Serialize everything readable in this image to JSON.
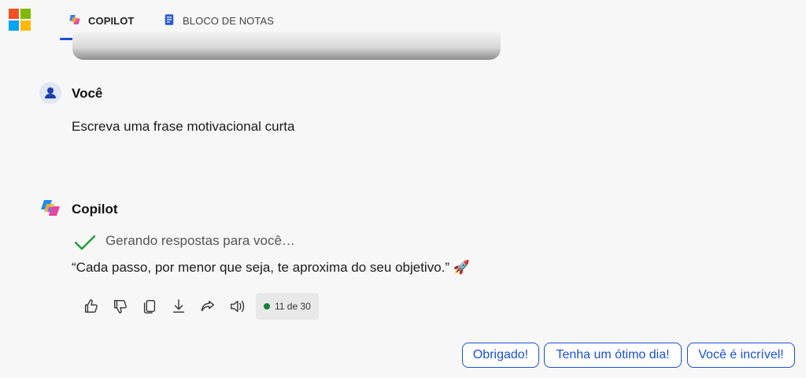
{
  "tabs": [
    {
      "label": "COPILOT",
      "icon": "copilot-icon",
      "active": true
    },
    {
      "label": "BLOCO DE NOTAS",
      "icon": "notebook-icon",
      "active": false
    }
  ],
  "conversation": {
    "user": {
      "name": "Você",
      "message": "Escreva uma frase motivacional curta"
    },
    "copilot": {
      "name": "Copilot",
      "status": "Gerando respostas para você…",
      "message": "“Cada passo, por menor que seja, te aproxima do seu objetivo.” 🚀",
      "counter": "11 de 30"
    }
  },
  "suggestions": [
    "Obrigado!",
    "Tenha um ótimo dia!",
    "Você é incrível!"
  ],
  "colors": {
    "accent": "#1a4fd6",
    "check": "#1e9e3a",
    "counter_dot": "#1e7a3c"
  }
}
